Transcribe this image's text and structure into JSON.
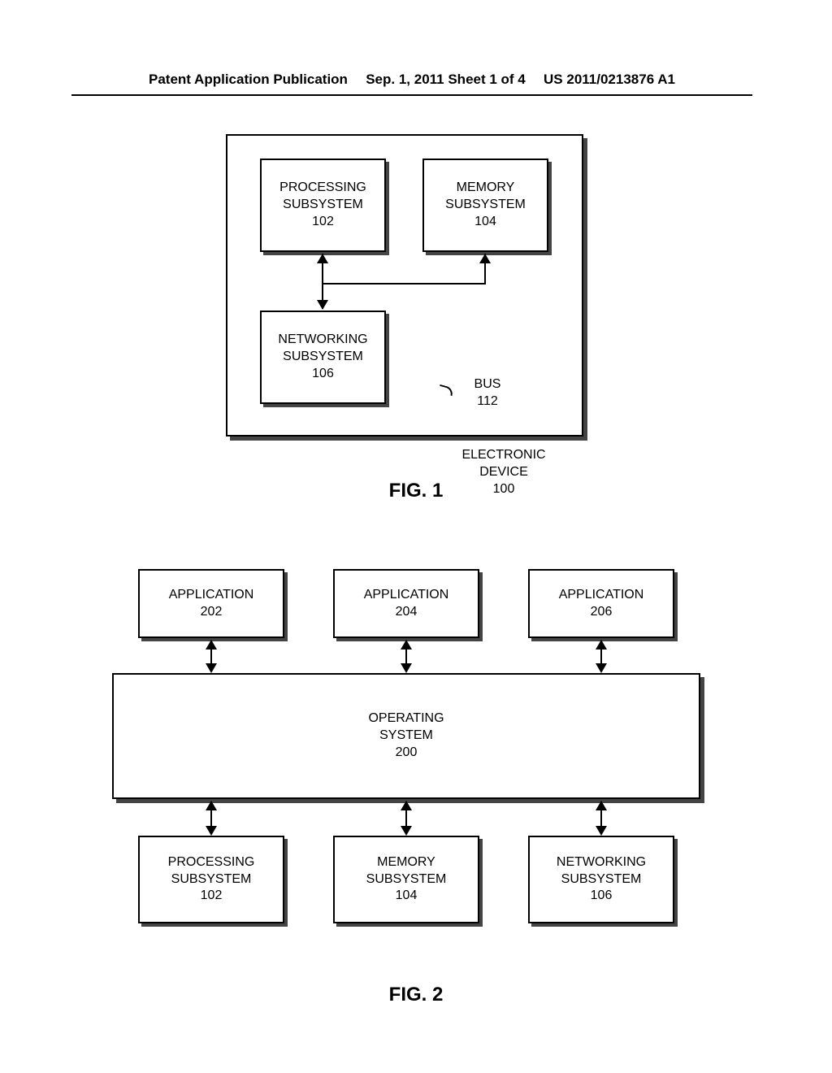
{
  "header": {
    "left": "Patent Application Publication",
    "center": "Sep. 1, 2011  Sheet 1 of 4",
    "right": "US 2011/0213876 A1"
  },
  "fig1": {
    "processing": {
      "line1": "PROCESSING",
      "line2": "SUBSYSTEM",
      "num": "102"
    },
    "memory": {
      "line1": "MEMORY",
      "line2": "SUBSYSTEM",
      "num": "104"
    },
    "networking": {
      "line1": "NETWORKING",
      "line2": "SUBSYSTEM",
      "num": "106"
    },
    "bus": {
      "label": "BUS",
      "num": "112"
    },
    "device": {
      "line1": "ELECTRONIC",
      "line2": "DEVICE",
      "num": "100"
    },
    "caption": "FIG. 1"
  },
  "fig2": {
    "app1": {
      "label": "APPLICATION",
      "num": "202"
    },
    "app2": {
      "label": "APPLICATION",
      "num": "204"
    },
    "app3": {
      "label": "APPLICATION",
      "num": "206"
    },
    "os": {
      "line1": "OPERATING",
      "line2": "SYSTEM",
      "num": "200"
    },
    "sub1": {
      "line1": "PROCESSING",
      "line2": "SUBSYSTEM",
      "num": "102"
    },
    "sub2": {
      "line1": "MEMORY",
      "line2": "SUBSYSTEM",
      "num": "104"
    },
    "sub3": {
      "line1": "NETWORKING",
      "line2": "SUBSYSTEM",
      "num": "106"
    },
    "caption": "FIG. 2"
  }
}
